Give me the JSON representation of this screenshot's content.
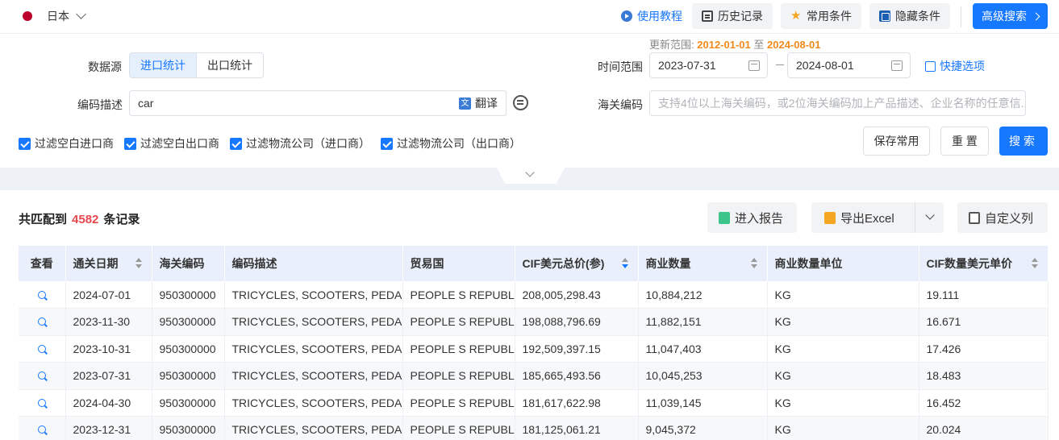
{
  "topbar": {
    "country": "日本",
    "tutorial": "使用教程",
    "history": "历史记录",
    "common": "常用条件",
    "hide": "隐藏条件",
    "advanced": "高级搜索"
  },
  "filters": {
    "range_note_prefix": "更新范围:",
    "range_start": "2012-01-01",
    "range_mid": "至",
    "range_end": "2024-08-01",
    "source_label": "数据源",
    "source_options": [
      "进口统计",
      "出口统计"
    ],
    "time_label": "时间范围",
    "date_from": "2023-07-31",
    "date_to": "2024-08-01",
    "quick": "快捷选项",
    "desc_label": "编码描述",
    "desc_value": "car",
    "translate": "翻译",
    "hs_label": "海关编码",
    "hs_placeholder": "支持4位以上海关编码，或2位海关编码加上产品描述、企业名称的任意信...",
    "checks": [
      "过滤空白进口商",
      "过滤空白出口商",
      "过滤物流公司（进口商）",
      "过滤物流公司（出口商）"
    ],
    "save_common": "保存常用",
    "reset": "重 置",
    "search": "搜索"
  },
  "results": {
    "count_prefix": "共匹配到",
    "count": "4582",
    "count_suffix": "条记录",
    "report": "进入报告",
    "export": "导出Excel",
    "customize": "自定义列",
    "columns": [
      "查看",
      "通关日期",
      "海关编码",
      "编码描述",
      "贸易国",
      "CIF美元总价(参)",
      "商业数量",
      "商业数量单位",
      "CIF数量美元单价"
    ],
    "rows": [
      {
        "date": "2024-07-01",
        "hs": "950300000",
        "desc": "TRICYCLES, SCOOTERS, PEDAL",
        "country": "PEOPLE S REPUBLI",
        "cif": "208,005,298.43",
        "qty": "10,884,212",
        "unit": "KG",
        "price": "19.111"
      },
      {
        "date": "2023-11-30",
        "hs": "950300000",
        "desc": "TRICYCLES, SCOOTERS, PEDAL",
        "country": "PEOPLE S REPUBLI",
        "cif": "198,088,796.69",
        "qty": "11,882,151",
        "unit": "KG",
        "price": "16.671"
      },
      {
        "date": "2023-10-31",
        "hs": "950300000",
        "desc": "TRICYCLES, SCOOTERS, PEDAL",
        "country": "PEOPLE S REPUBLI",
        "cif": "192,509,397.15",
        "qty": "11,047,403",
        "unit": "KG",
        "price": "17.426"
      },
      {
        "date": "2023-07-31",
        "hs": "950300000",
        "desc": "TRICYCLES, SCOOTERS, PEDAL",
        "country": "PEOPLE S REPUBLI",
        "cif": "185,665,493.56",
        "qty": "10,045,253",
        "unit": "KG",
        "price": "18.483"
      },
      {
        "date": "2024-04-30",
        "hs": "950300000",
        "desc": "TRICYCLES, SCOOTERS, PEDAL",
        "country": "PEOPLE S REPUBLI",
        "cif": "181,617,622.98",
        "qty": "11,039,145",
        "unit": "KG",
        "price": "16.452"
      },
      {
        "date": "2023-12-31",
        "hs": "950300000",
        "desc": "TRICYCLES, SCOOTERS, PEDAL",
        "country": "PEOPLE S REPUBLI",
        "cif": "181,125,061.21",
        "qty": "9,045,372",
        "unit": "KG",
        "price": "20.024"
      }
    ]
  }
}
